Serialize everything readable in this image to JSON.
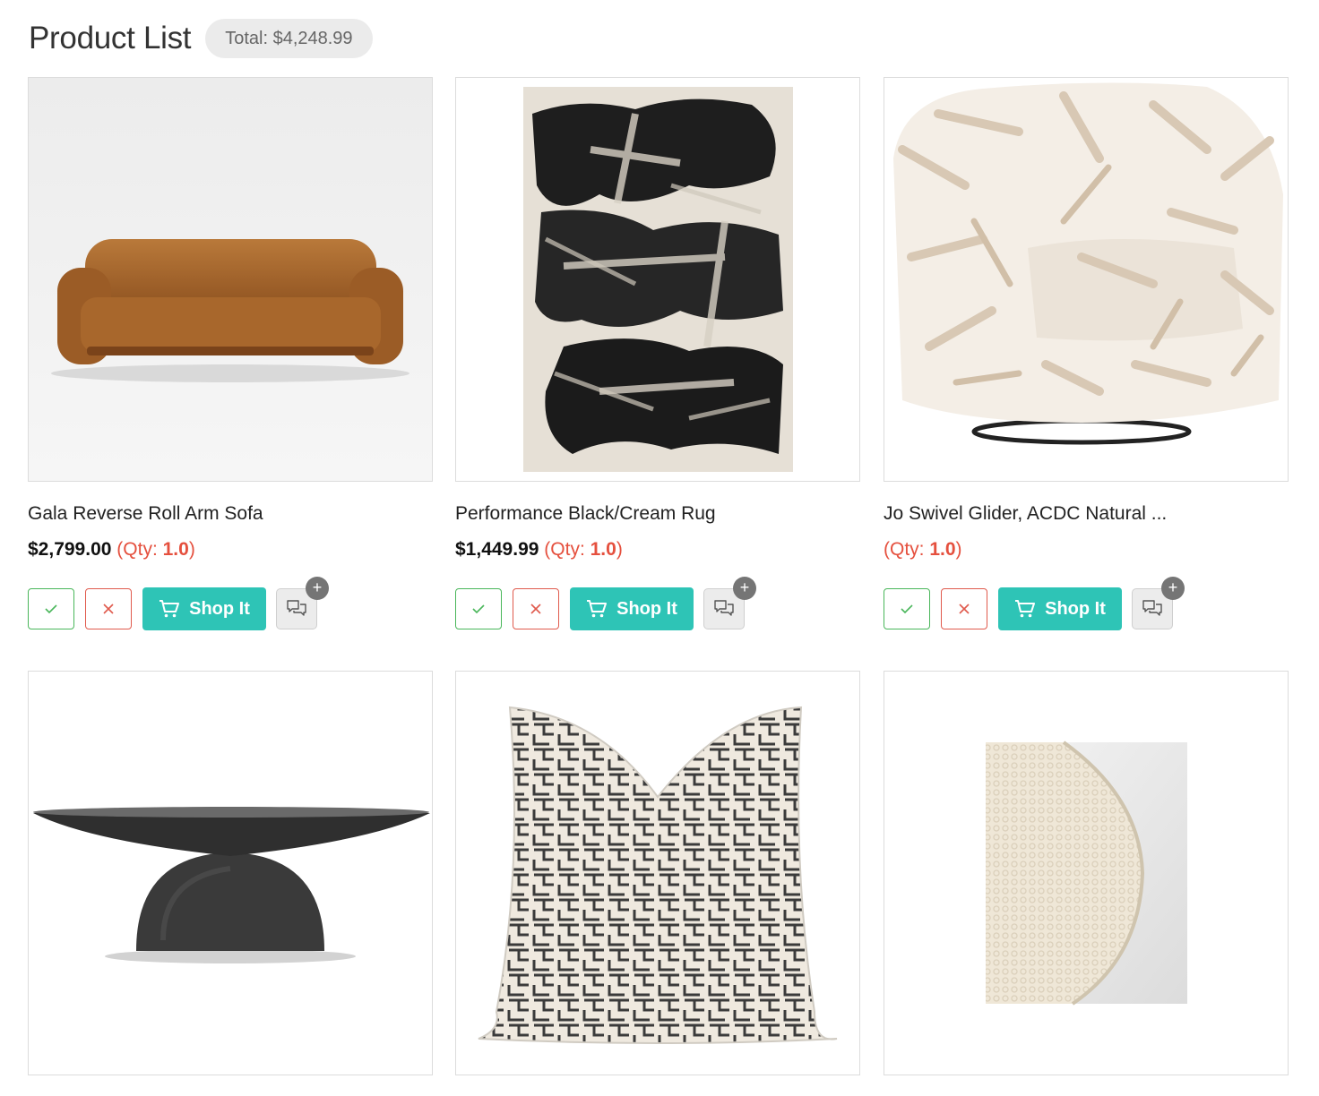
{
  "header": {
    "title": "Product List",
    "total": "Total: $4,248.99"
  },
  "actions": {
    "shop_label": "Shop It",
    "plus": "+"
  },
  "products": [
    {
      "name": "Gala Reverse Roll Arm Sofa",
      "price": "$2,799.00",
      "qty_prefix": "(Qty: ",
      "qty": "1.0",
      "qty_suffix": ")",
      "image": "velvet-sofa"
    },
    {
      "name": "Performance Black/Cream Rug",
      "price": "$1,449.99",
      "qty_prefix": "(Qty: ",
      "qty": "1.0",
      "qty_suffix": ")",
      "image": "abstract-rug"
    },
    {
      "name": "Jo Swivel Glider, ACDC Natural ...",
      "price": "",
      "qty_prefix": "(Qty: ",
      "qty": "1.0",
      "qty_suffix": ")",
      "image": "swivel-chair"
    },
    {
      "name": "",
      "price": "",
      "image": "pedestal-coffee-table"
    },
    {
      "name": "",
      "price": "",
      "image": "patterned-pillow"
    },
    {
      "name": "",
      "price": "",
      "image": "boucle-ball"
    }
  ],
  "colors": {
    "accent": "#2ec4b6",
    "approve": "#49b65a",
    "reject": "#e05a4d",
    "qty": "#e5503e",
    "badge_bg": "#ebebeb"
  }
}
